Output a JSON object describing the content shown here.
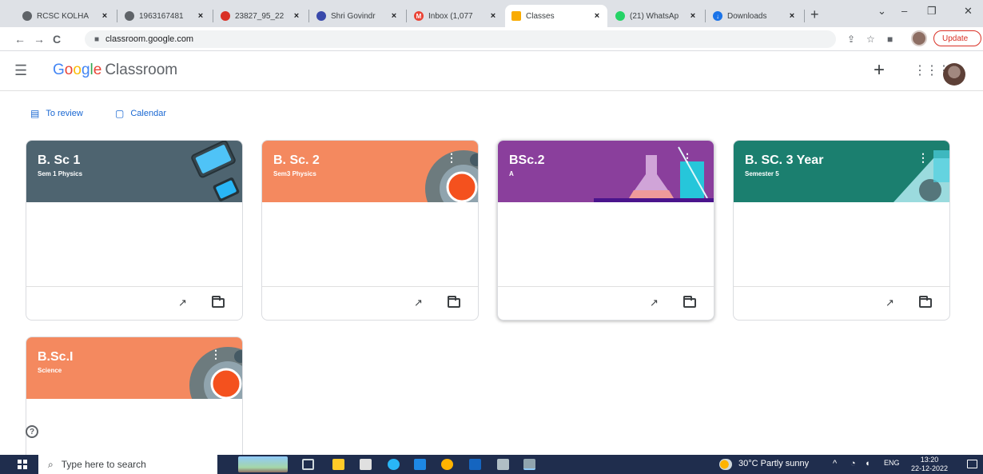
{
  "browser": {
    "tabs": [
      {
        "label": "RCSC KOLHA",
        "icon": "globe-icon",
        "color": "#5f6368",
        "active": false
      },
      {
        "label": "1963167481",
        "icon": "globe-icon",
        "color": "#5f6368",
        "active": false
      },
      {
        "label": "23827_95_22",
        "icon": "pdf-icon",
        "color": "#d93025",
        "active": false
      },
      {
        "label": "Shri Govindr",
        "icon": "site-icon",
        "color": "#3949ab",
        "active": false
      },
      {
        "label": "Inbox (1,077",
        "icon": "gmail-icon",
        "color": "#ea4335",
        "active": false
      },
      {
        "label": "Classes",
        "icon": "classroom-icon",
        "color": "#f9ab00",
        "active": true
      },
      {
        "label": "(21) WhatsAp",
        "icon": "whatsapp-icon",
        "color": "#25d366",
        "active": false
      },
      {
        "label": "Downloads",
        "icon": "download-icon",
        "color": "#1a73e8",
        "active": false
      }
    ],
    "url": "classroom.google.com",
    "update_label": "Update"
  },
  "header": {
    "brand_google": "Google",
    "brand_product": "Classroom",
    "google_colors": [
      "#4285f4",
      "#ea4335",
      "#fbbc05",
      "#4285f4",
      "#34a853",
      "#ea4335"
    ]
  },
  "subnav": {
    "to_review": "To review",
    "calendar": "Calendar"
  },
  "classes": [
    {
      "title": "B. Sc 1",
      "section": "Sem 1 Physics",
      "color": "#4e6470",
      "theme": "devices"
    },
    {
      "title": "B. Sc. 2",
      "section": "Sem3 Physics",
      "color": "#f4895f",
      "theme": "petri-dish"
    },
    {
      "title": "BSc.2",
      "section": "A",
      "color": "#8a3f9c",
      "theme": "lab-glassware"
    },
    {
      "title": "B. SC. 3 Year",
      "section": "Semester 5",
      "color": "#1b7f6f",
      "theme": "lab-glassware"
    },
    {
      "title": "B.Sc.I",
      "section": "Science",
      "color": "#f4895f",
      "theme": "petri-dish"
    }
  ],
  "help_icon": "help-icon",
  "taskbar": {
    "search_placeholder": "Type here to search",
    "weather": "30°C  Partly sunny",
    "language": "ENG",
    "time": "13:20",
    "date": "22-12-2022"
  }
}
